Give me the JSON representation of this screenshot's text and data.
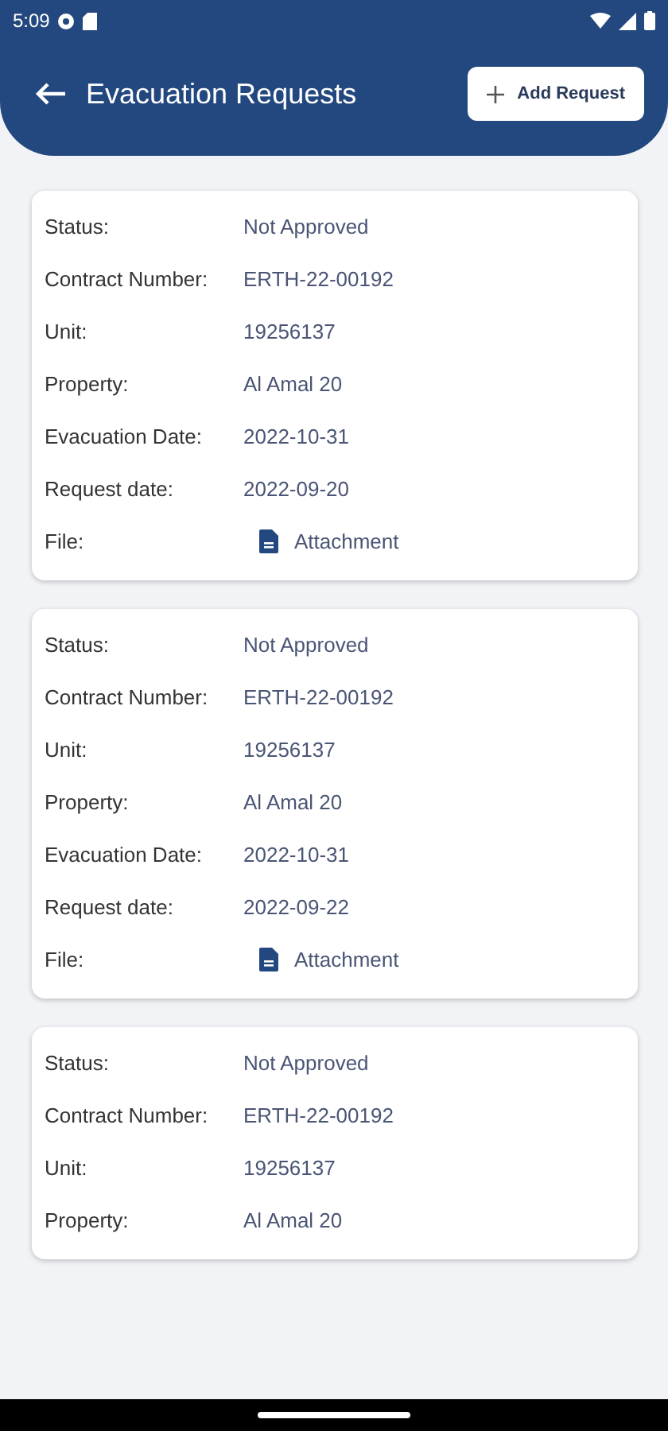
{
  "status_bar": {
    "time": "5:09"
  },
  "header": {
    "title": "Evacuation Requests",
    "add_button": "Add Request"
  },
  "requests": [
    {
      "rows": [
        {
          "kind": "text",
          "label": "Status:",
          "value": "Not Approved"
        },
        {
          "kind": "text",
          "label": "Contract Number:",
          "value": "ERTH-22-00192"
        },
        {
          "kind": "text",
          "label": "Unit:",
          "value": "19256137"
        },
        {
          "kind": "text",
          "label": "Property:",
          "value": "Al Amal 20"
        },
        {
          "kind": "text",
          "label": "Evacuation Date:",
          "value": "2022-10-31"
        },
        {
          "kind": "text",
          "label": "Request date:",
          "value": "2022-09-20"
        },
        {
          "kind": "file",
          "label": "File:",
          "value": "Attachment"
        }
      ]
    },
    {
      "rows": [
        {
          "kind": "text",
          "label": "Status:",
          "value": "Not Approved"
        },
        {
          "kind": "text",
          "label": "Contract Number:",
          "value": "ERTH-22-00192"
        },
        {
          "kind": "text",
          "label": "Unit:",
          "value": "19256137"
        },
        {
          "kind": "text",
          "label": "Property:",
          "value": "Al Amal 20"
        },
        {
          "kind": "text",
          "label": "Evacuation Date:",
          "value": "2022-10-31"
        },
        {
          "kind": "text",
          "label": "Request date:",
          "value": "2022-09-22"
        },
        {
          "kind": "file",
          "label": "File:",
          "value": "Attachment"
        }
      ]
    },
    {
      "rows": [
        {
          "kind": "text",
          "label": "Status:",
          "value": "Not Approved"
        },
        {
          "kind": "text",
          "label": "Contract Number:",
          "value": "ERTH-22-00192"
        },
        {
          "kind": "text",
          "label": "Unit:",
          "value": "19256137"
        },
        {
          "kind": "text",
          "label": "Property:",
          "value": "Al Amal 20"
        }
      ]
    }
  ]
}
